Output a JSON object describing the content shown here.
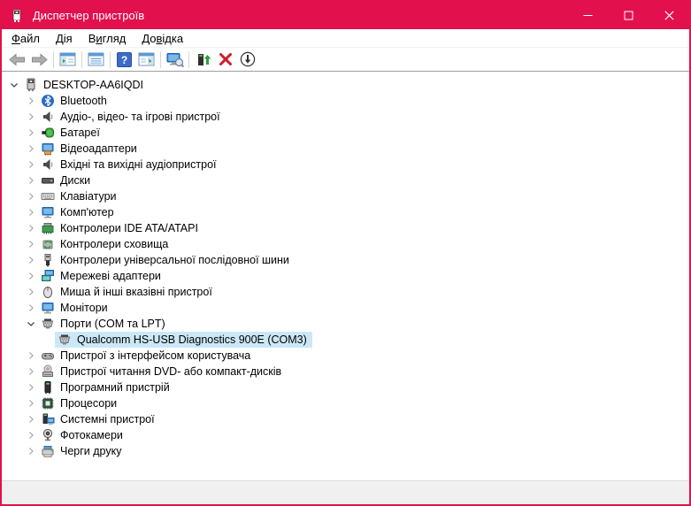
{
  "colors": {
    "accent": "#E2104C",
    "titlebar_text": "#FFFFFF",
    "selection": "#CBE8F6",
    "statusbar_bg": "#F0F0F0"
  },
  "window": {
    "title": "Диспетчер пристроїв",
    "controls": [
      {
        "name": "minimize",
        "icon": "minimize-icon"
      },
      {
        "name": "maximize",
        "icon": "maximize-icon"
      },
      {
        "name": "close",
        "icon": "close-icon"
      }
    ]
  },
  "menu": {
    "items": [
      {
        "name": "file",
        "label": "Файл",
        "underline": 0
      },
      {
        "name": "action",
        "label": "Дія",
        "underline": 0
      },
      {
        "name": "view",
        "label": "Вигляд",
        "underline": 1
      },
      {
        "name": "help",
        "label": "Довідка",
        "underline": 2
      }
    ]
  },
  "toolbar": {
    "groups": [
      {
        "buttons": [
          {
            "name": "back",
            "icon": "back-arrow-icon"
          },
          {
            "name": "forward",
            "icon": "forward-arrow-icon"
          }
        ]
      },
      {
        "buttons": [
          {
            "name": "console-tree",
            "icon": "console-tree-icon"
          }
        ]
      },
      {
        "buttons": [
          {
            "name": "properties",
            "icon": "properties-icon"
          }
        ]
      },
      {
        "buttons": [
          {
            "name": "help",
            "icon": "help-icon"
          },
          {
            "name": "action-pane",
            "icon": "action-pane-icon"
          }
        ]
      },
      {
        "buttons": [
          {
            "name": "scan-hardware-changes",
            "icon": "scan-hardware-icon"
          }
        ]
      },
      {
        "buttons": [
          {
            "name": "update-driver",
            "icon": "update-driver-icon"
          },
          {
            "name": "uninstall-device",
            "icon": "uninstall-icon"
          },
          {
            "name": "disable-device",
            "icon": "disable-icon"
          }
        ]
      }
    ]
  },
  "tree": {
    "rows": [
      {
        "name": "computer-root",
        "label": "DESKTOP-AA6IQDI",
        "icon": "computer-device-icon",
        "level": 0,
        "state": "expanded",
        "selected": false
      },
      {
        "name": "bluetooth",
        "label": "Bluetooth",
        "icon": "bluetooth-icon",
        "level": 1,
        "state": "collapsed",
        "selected": false
      },
      {
        "name": "audio-video-game-devices",
        "label": "Аудіо-, відео- та ігрові пристрої",
        "icon": "speaker-icon",
        "level": 1,
        "state": "collapsed",
        "selected": false
      },
      {
        "name": "batteries",
        "label": "Батареї",
        "icon": "battery-icon",
        "level": 1,
        "state": "collapsed",
        "selected": false
      },
      {
        "name": "display-adapters",
        "label": "Відеоадаптери",
        "icon": "display-adapter-icon",
        "level": 1,
        "state": "collapsed",
        "selected": false
      },
      {
        "name": "audio-inputs-outputs",
        "label": "Вхідні та вихідні аудіопристрої",
        "icon": "speaker-icon",
        "level": 1,
        "state": "collapsed",
        "selected": false
      },
      {
        "name": "disk-drives",
        "label": "Диски",
        "icon": "disk-icon",
        "level": 1,
        "state": "collapsed",
        "selected": false
      },
      {
        "name": "keyboards",
        "label": "Клавіатури",
        "icon": "keyboard-icon",
        "level": 1,
        "state": "collapsed",
        "selected": false
      },
      {
        "name": "computer",
        "label": "Комп'ютер",
        "icon": "monitor-icon",
        "level": 1,
        "state": "collapsed",
        "selected": false
      },
      {
        "name": "ide-controllers",
        "label": "Контролери IDE ATA/ATAPI",
        "icon": "ide-controller-icon",
        "level": 1,
        "state": "collapsed",
        "selected": false
      },
      {
        "name": "storage-controllers",
        "label": "Контролери сховища",
        "icon": "storage-controller-icon",
        "level": 1,
        "state": "collapsed",
        "selected": false
      },
      {
        "name": "usb-controllers",
        "label": "Контролери універсальної послідовної шини",
        "icon": "usb-icon",
        "level": 1,
        "state": "collapsed",
        "selected": false
      },
      {
        "name": "network-adapters",
        "label": "Мережеві адаптери",
        "icon": "network-icon",
        "level": 1,
        "state": "collapsed",
        "selected": false
      },
      {
        "name": "mice-pointing-devices",
        "label": "Миша й інші вказівні пристрої",
        "icon": "mouse-icon",
        "level": 1,
        "state": "collapsed",
        "selected": false
      },
      {
        "name": "monitors",
        "label": "Монітори",
        "icon": "monitor-icon",
        "level": 1,
        "state": "collapsed",
        "selected": false
      },
      {
        "name": "ports-com-lpt",
        "label": "Порти (COM та LPT)",
        "icon": "serial-port-icon",
        "level": 1,
        "state": "expanded",
        "selected": false
      },
      {
        "name": "qualcomm-port",
        "label": "Qualcomm HS-USB Diagnostics 900E (COM3)",
        "icon": "serial-port-icon",
        "level": 2,
        "state": "none",
        "selected": true
      },
      {
        "name": "human-interface-devices",
        "label": "Пристрої з інтерфейсом користувача",
        "icon": "hid-icon",
        "level": 1,
        "state": "collapsed",
        "selected": false
      },
      {
        "name": "dvd-cdrom-drives",
        "label": "Пристрої читання DVD- або компакт-дисків",
        "icon": "dvd-drive-icon",
        "level": 1,
        "state": "collapsed",
        "selected": false
      },
      {
        "name": "software-device",
        "label": "Програмний пристрій",
        "icon": "software-device-icon",
        "level": 1,
        "state": "collapsed",
        "selected": false
      },
      {
        "name": "processors",
        "label": "Процесори",
        "icon": "processor-icon",
        "level": 1,
        "state": "collapsed",
        "selected": false
      },
      {
        "name": "system-devices",
        "label": "Системні пристрої",
        "icon": "system-device-icon",
        "level": 1,
        "state": "collapsed",
        "selected": false
      },
      {
        "name": "cameras",
        "label": "Фотокамери",
        "icon": "camera-icon",
        "level": 1,
        "state": "collapsed",
        "selected": false
      },
      {
        "name": "print-queues",
        "label": "Черги друку",
        "icon": "printer-icon",
        "level": 1,
        "state": "collapsed",
        "selected": false
      }
    ]
  },
  "statusbar": {
    "text": ""
  }
}
